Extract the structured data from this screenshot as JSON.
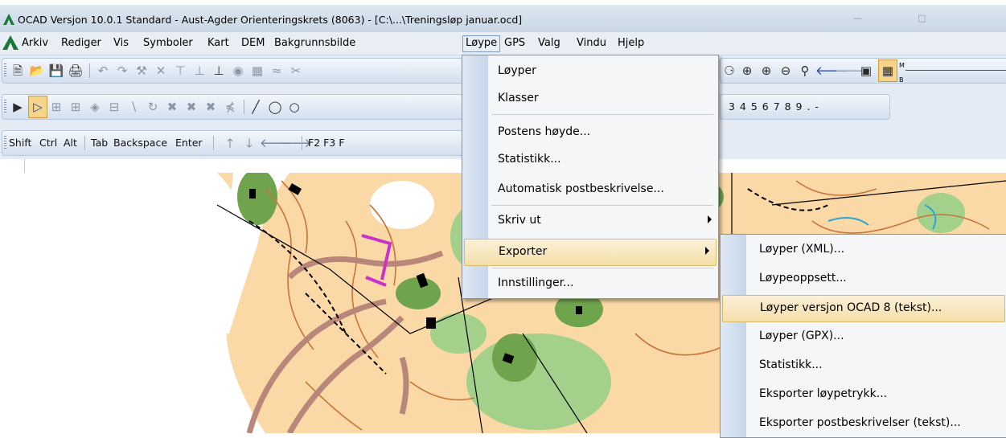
{
  "window": {
    "title": "OCAD Versjon 10.0.1  Standard - Aust-Agder Orienteringskrets (8063) - [C:\\...\\Treningsløp januar.ocd]"
  },
  "menubar": {
    "items": [
      {
        "label": "Arkiv"
      },
      {
        "label": "Rediger"
      },
      {
        "label": "Vis"
      },
      {
        "label": "Symboler"
      },
      {
        "label": "Kart"
      },
      {
        "label": "DEM"
      },
      {
        "label": "Bakgrunnsbilde"
      },
      {
        "label": "Løype",
        "active": true
      },
      {
        "label": "GPS"
      },
      {
        "label": "Valg"
      },
      {
        "label": "Vindu"
      },
      {
        "label": "Hjelp"
      }
    ]
  },
  "keybar": {
    "keys1": [
      "Shift",
      "Ctrl",
      "Alt"
    ],
    "keys2": [
      "Tab",
      "Backspace",
      "Enter"
    ],
    "fkeys": "F2 F3 F"
  },
  "numbar": {
    "digits": "3 4 5 6 7 8 9 . -"
  },
  "loype_menu": {
    "items": [
      {
        "label": "Løyper"
      },
      {
        "label": "Klasser"
      },
      {
        "label": "Postens høyde..."
      },
      {
        "label": "Statistikk..."
      },
      {
        "label": "Automatisk postbeskrivelse..."
      },
      {
        "label": "Skriv ut",
        "submenu": true
      },
      {
        "label": "Exporter",
        "submenu": true,
        "highlighted": true
      },
      {
        "label": "Innstillinger..."
      }
    ]
  },
  "export_submenu": {
    "items": [
      {
        "label": "Løyper (XML)..."
      },
      {
        "label": "Løypeoppsett..."
      },
      {
        "label": "Løyper versjon OCAD 8 (tekst)...",
        "highlighted": true
      },
      {
        "label": "Løyper (GPX)..."
      },
      {
        "label": "Statistikk..."
      },
      {
        "label": "Eksporter løypetrykk..."
      },
      {
        "label": "Eksporter postbeskrivelser (tekst)..."
      }
    ]
  },
  "colors": {
    "accent": "#f4dfa8",
    "map_orange": "#f5c98f",
    "map_green": "#a3d08a",
    "course_magenta": "#c832c8"
  }
}
